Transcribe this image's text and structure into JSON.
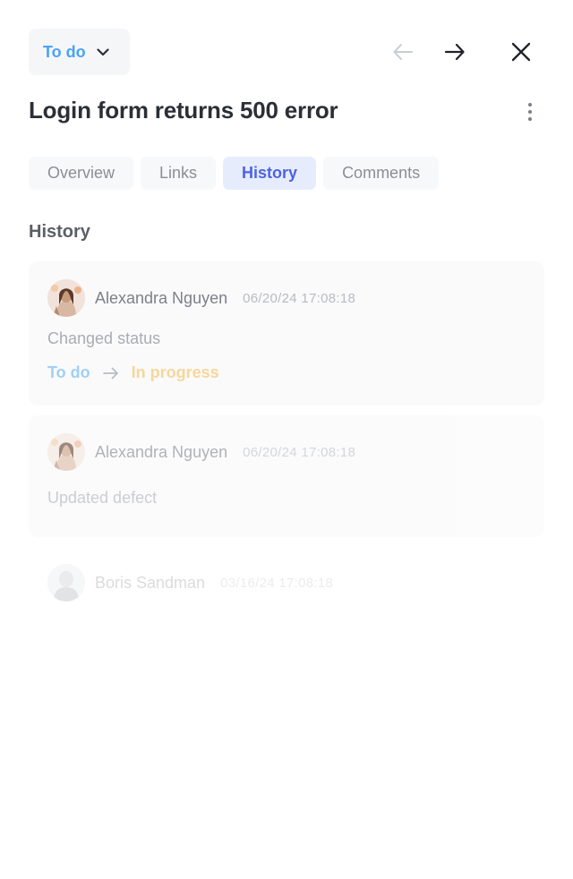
{
  "header": {
    "status_label": "To do",
    "status_color": "#4aa3f5",
    "prev_icon": "arrow-left-icon",
    "next_icon": "arrow-right-icon",
    "close_icon": "close-icon"
  },
  "title": "Login form returns 500 error",
  "tabs": [
    {
      "label": "Overview",
      "active": false
    },
    {
      "label": "Links",
      "active": false
    },
    {
      "label": "History",
      "active": true
    },
    {
      "label": "Comments",
      "active": false
    }
  ],
  "section_title": "History",
  "history": [
    {
      "author": "Alexandra Nguyen",
      "timestamp": "06/20/24 17:08:18",
      "action": "Changed status",
      "from": "To do",
      "to": "In progress",
      "from_color": "#9fd0f6",
      "to_color": "#f6d79a"
    },
    {
      "author": "Alexandra Nguyen",
      "timestamp": "06/20/24 17:08:18",
      "action": "Updated defect"
    },
    {
      "author": "Boris Sandman",
      "timestamp": "03/16/24 17:08:18"
    }
  ]
}
